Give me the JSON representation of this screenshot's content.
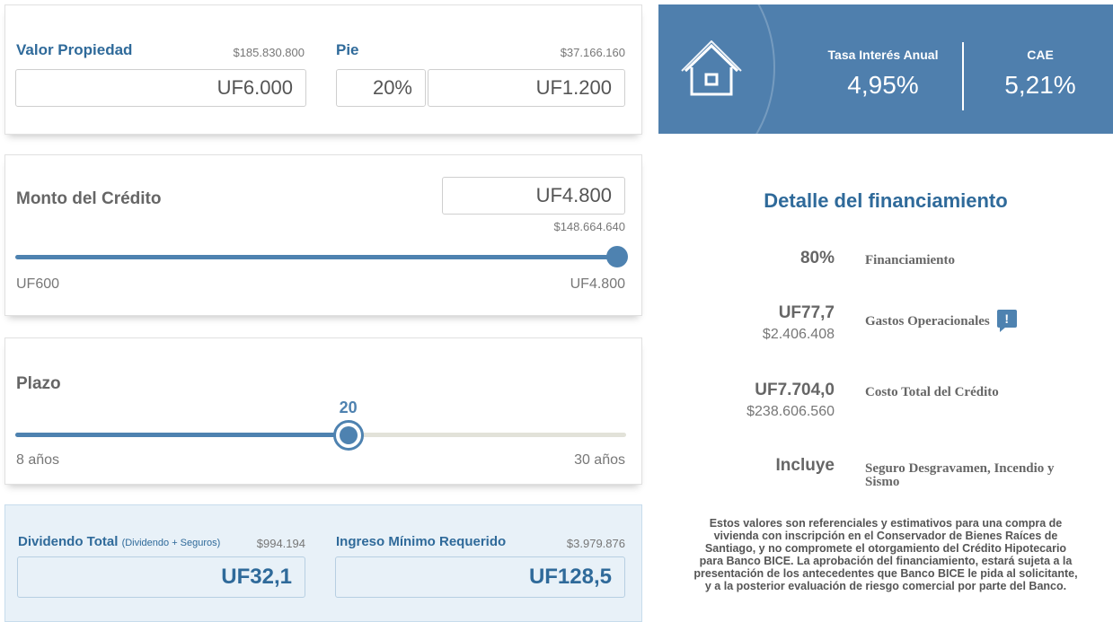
{
  "property": {
    "label": "Valor Propiedad",
    "pesos": "$185.830.800",
    "value": "UF6.000"
  },
  "pie": {
    "label": "Pie",
    "pesos": "$37.166.160",
    "percent": "20%",
    "value": "UF1.200"
  },
  "credit": {
    "label": "Monto del Crédito",
    "value": "UF4.800",
    "pesos": "$148.664.640",
    "min": "UF600",
    "max": "UF4.800",
    "slider_fraction": 1.0
  },
  "term": {
    "label": "Plazo",
    "current": "20",
    "min": "8 años",
    "max": "30 años",
    "slider_fraction": 0.545
  },
  "dividend": {
    "label": "Dividendo Total",
    "note": "(Dividendo + Seguros)",
    "pesos": "$994.194",
    "value": "UF32,1"
  },
  "income": {
    "label": "Ingreso Mínimo Requerido",
    "pesos": "$3.979.876",
    "value": "UF128,5"
  },
  "rates": {
    "tasa_label": "Tasa Interés Anual",
    "tasa_value": "4,95%",
    "cae_label": "CAE",
    "cae_value": "5,21%"
  },
  "detail": {
    "title": "Detalle del financiamiento",
    "rows": [
      {
        "value": "80%",
        "sub": "",
        "desc": "Financiamiento"
      },
      {
        "value": "UF77,7",
        "sub": "$2.406.408",
        "desc": "Gastos Operacionales"
      },
      {
        "value": "UF7.704,0",
        "sub": "$238.606.560",
        "desc": "Costo Total del Crédito"
      },
      {
        "value": "Incluye",
        "sub": "",
        "desc": "Seguro Desgravamen, Incendio y",
        "desc2": "Sismo"
      }
    ],
    "info_icon": "!"
  },
  "disclaimer": [
    "Estos valores son referenciales y estimativos para una compra de",
    "vivienda con inscripción en el Conservador de Bienes Raíces de",
    "Santiago, y no compromete el otorgamiento del Crédito Hipotecario",
    "para Banco BICE. La aprobación del financiamiento, estará sujeta a la",
    "presentación de los antecedentes que Banco BICE le pida al solicitante,",
    "y a la posterior evaluación de riesgo comercial por parte del Banco."
  ],
  "colors": {
    "accent": "#4e82b0",
    "title_blue": "#2f6a9a",
    "panel": "#4f7fad",
    "result_bg": "#e8f1f8"
  }
}
